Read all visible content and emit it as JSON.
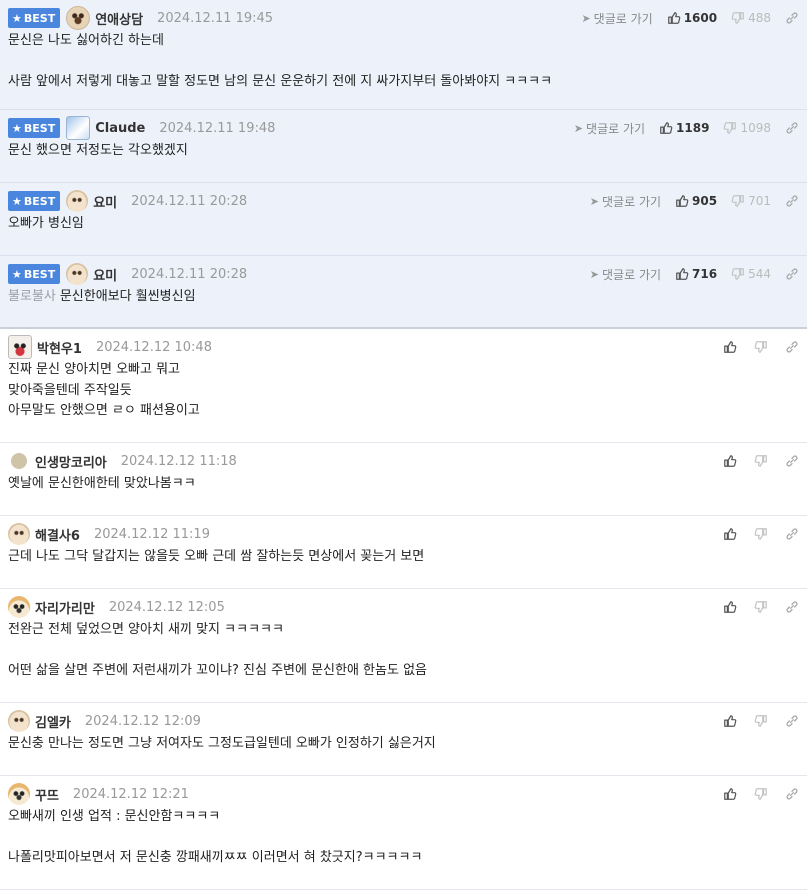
{
  "reply_label": "댓글로 가기",
  "best_label": "BEST",
  "best_comments": [
    {
      "nickname": "연애상담",
      "date": "2024.12.11 19:45",
      "up": "1600",
      "down": "488",
      "text": "문신은 나도 싫어하긴 하는데\n\n사람 앞에서 저렇게 대놓고 말할 정도면 남의 문신 운운하기 전에 지 싸가지부터 돌아봐야지 ㅋㅋㅋㅋ",
      "avatar_icon": "dog-avatar-icon"
    },
    {
      "nickname": "Claude",
      "date": "2024.12.11 19:48",
      "up": "1189",
      "down": "1098",
      "text": "문신 했으면 저정도는 각오했겠지",
      "avatar_icon": "snowy-avatar-icon"
    },
    {
      "nickname": "요미",
      "date": "2024.12.11 20:28",
      "up": "905",
      "down": "701",
      "text": "오빠가 병신임",
      "avatar_icon": "puppy-avatar-icon"
    },
    {
      "nickname": "요미",
      "date": "2024.12.11 20:28",
      "up": "716",
      "down": "544",
      "prefix": "불로불사",
      "text": "문신한애보다 훨씬병신임",
      "avatar_icon": "puppy-avatar-icon"
    }
  ],
  "comments": [
    {
      "nickname": "박현우1",
      "date": "2024.12.12 10:48",
      "text": "진짜 문신 양아치면 오빠고 뭐고\n맞아죽을텐데 주작일듯\n아무말도 안했으면 ㄹㅇ 패션용이고",
      "avatar_icon": "red-face-avatar-icon"
    },
    {
      "nickname": "인생망코리아",
      "date": "2024.12.12 11:18",
      "text": "옛날에 문신한애한테 맞았나봄ㅋㅋ",
      "avatar_icon": "beige-dot-avatar-icon"
    },
    {
      "nickname": "해결사6",
      "date": "2024.12.12 11:19",
      "text": "근데 나도 그닥 달갑지는 않을듯 오빠 근데 쌈 잘하는듯 면상에서 꽂는거 보면",
      "avatar_icon": "puppy-avatar-icon"
    },
    {
      "nickname": "자리가리만",
      "date": "2024.12.12 12:05",
      "text": "전완근 전체 덮었으면 양아치 새끼 맞지 ㅋㅋㅋㅋㅋ\n\n어떤 삶을 살면 주변에 저런새끼가 꼬이냐? 진심 주변에 문신한애 한놈도 없음",
      "avatar_icon": "fox-avatar-icon"
    },
    {
      "nickname": "김엘카",
      "date": "2024.12.12 12:09",
      "text": "문신충 만나는 정도면 그냥 저여자도 그정도급일텐데 오빠가 인정하기 싫은거지",
      "avatar_icon": "puppy-avatar-icon"
    },
    {
      "nickname": "꾸뜨",
      "date": "2024.12.12 12:21",
      "text": "오빠새끼 인생 업적 : 문신안함ㅋㅋㅋㅋ\n\n나폴리맛피아보면서 저 문신충 깡패새끼ㅉㅉ 이러면서 혀 찼긋지?ㅋㅋㅋㅋㅋ",
      "avatar_icon": "fox-avatar-icon"
    }
  ],
  "colors": {
    "best_badge": "#4a86de",
    "best_bg": "#edf2fa"
  }
}
